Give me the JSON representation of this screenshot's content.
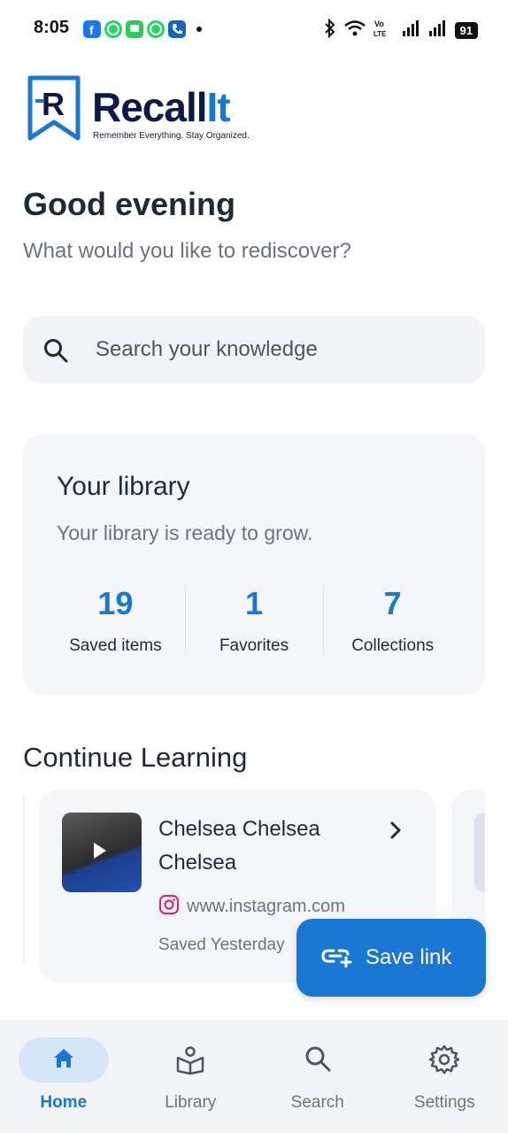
{
  "status_bar": {
    "time": "8:05",
    "battery": "91",
    "notification_icons": [
      "facebook-icon",
      "whatsapp-icon",
      "messages-icon",
      "whatsapp-business-icon",
      "phone-icon"
    ],
    "right_icons": [
      "bluetooth-icon",
      "wifi-icon",
      "volte-icon",
      "signal-icon",
      "signal-icon"
    ]
  },
  "app": {
    "name_part1": "Recall",
    "name_part2": "It",
    "tagline": "Remember Everything. Stay Organized.",
    "brand_color": "#1a78d4",
    "navy_color": "#0d1a47"
  },
  "greeting": {
    "title": "Good evening",
    "subtitle": "What would you like to rediscover?"
  },
  "search": {
    "placeholder": "Search your knowledge"
  },
  "library": {
    "title": "Your library",
    "subtitle": "Your library is ready to grow.",
    "stats": [
      {
        "value": "19",
        "label": "Saved items"
      },
      {
        "value": "1",
        "label": "Favorites"
      },
      {
        "value": "7",
        "label": "Collections"
      }
    ]
  },
  "continue_learning": {
    "title": "Continue Learning",
    "items": [
      {
        "title": "Chelsea Chelsea Chelsea",
        "source": "www.instagram.com",
        "source_icon": "instagram-icon",
        "saved": "Saved Yesterday"
      }
    ]
  },
  "fab": {
    "label": "Save link",
    "icon": "add-link-icon"
  },
  "nav": {
    "items": [
      {
        "label": "Home",
        "icon": "home-icon",
        "active": true
      },
      {
        "label": "Library",
        "icon": "library-icon",
        "active": false
      },
      {
        "label": "Search",
        "icon": "search-icon",
        "active": false
      },
      {
        "label": "Settings",
        "icon": "gear-icon",
        "active": false
      }
    ]
  }
}
